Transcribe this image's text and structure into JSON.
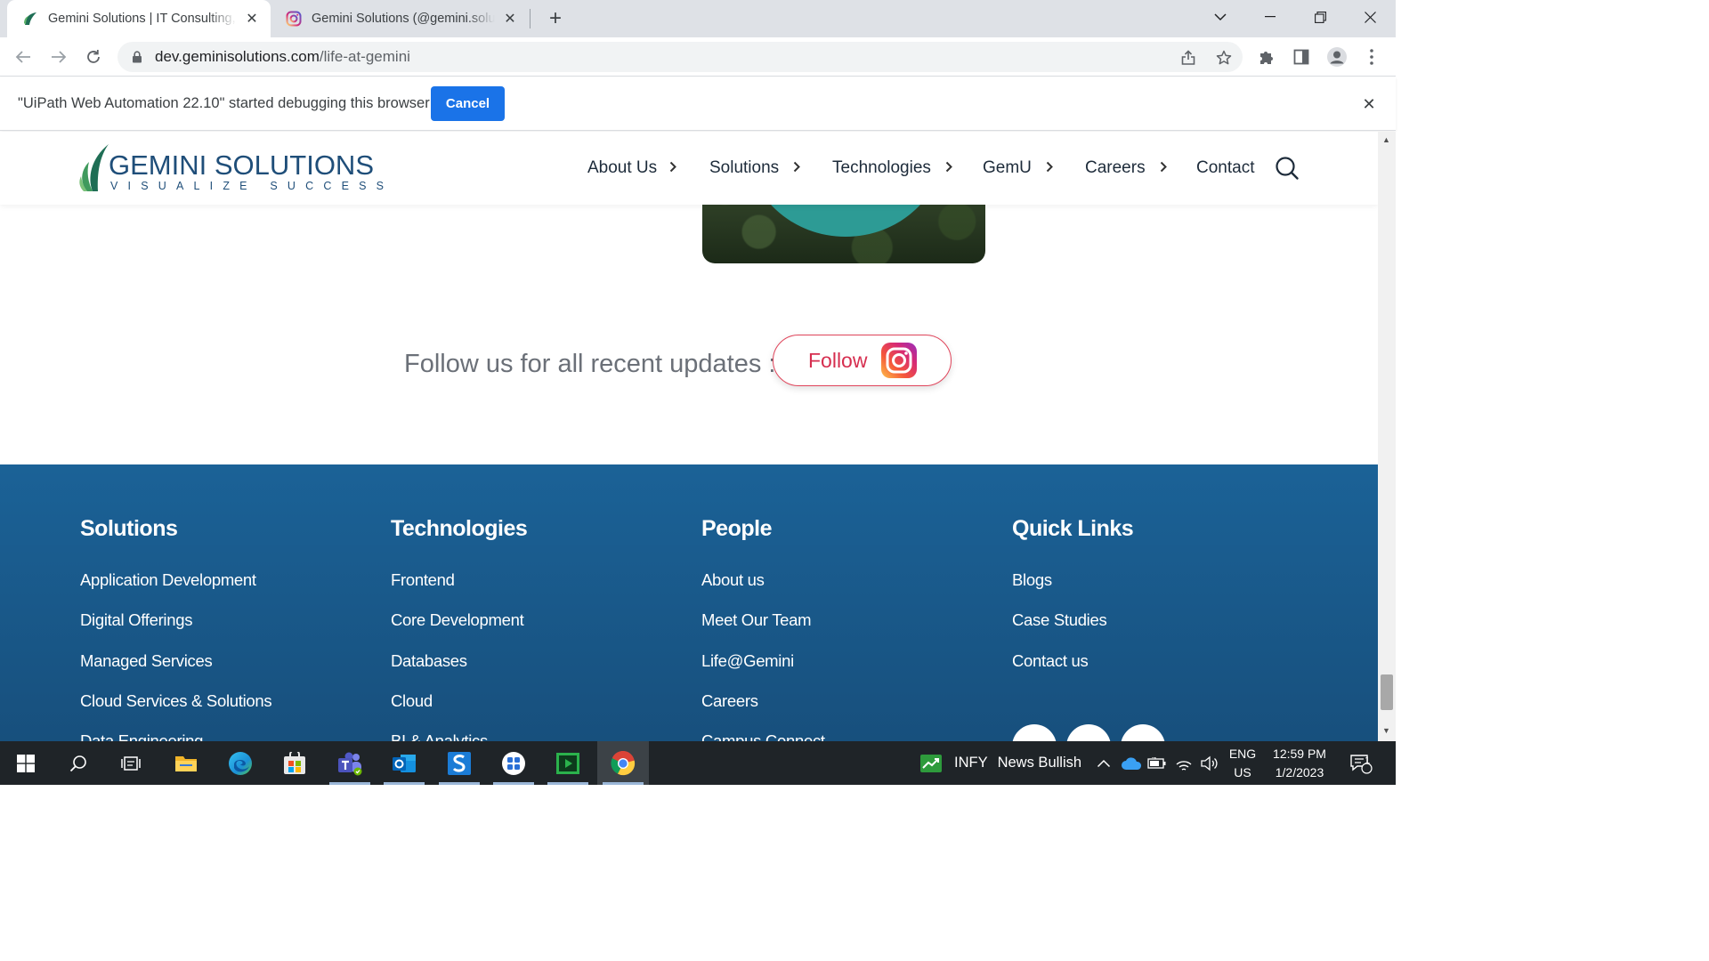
{
  "browser": {
    "tabs": [
      {
        "title": "Gemini Solutions | IT Consulting, Software Development",
        "active": true,
        "close": "✕"
      },
      {
        "title": "Gemini Solutions (@gemini.solutions) • Instagram",
        "active": false,
        "close": "✕"
      }
    ],
    "new_tab": "+",
    "url_domain": "dev.geminisolutions.com",
    "url_path": "/life-at-gemini"
  },
  "infobar": {
    "message": "\"UiPath Web Automation 22.10\" started debugging this browser",
    "cancel_label": "Cancel",
    "close": "✕"
  },
  "site": {
    "logo": {
      "word_main": "GEMINI",
      "word_rest": " SOLUTIONS",
      "tagline": "VISUALIZE SUCCESS"
    },
    "nav": [
      {
        "label": "About Us",
        "has_chevron": true
      },
      {
        "label": "Solutions",
        "has_chevron": true
      },
      {
        "label": "Technologies",
        "has_chevron": true
      },
      {
        "label": "GemU",
        "has_chevron": true
      },
      {
        "label": "Careers",
        "has_chevron": true
      },
      {
        "label": "Contact",
        "has_chevron": false
      }
    ],
    "chevron": "›",
    "follow_text": "Follow us for all recent updates :",
    "follow_button": "Follow"
  },
  "footer": {
    "columns": [
      {
        "heading": "Solutions",
        "links": [
          "Application Development",
          "Digital Offerings",
          "Managed Services",
          "Cloud Services & Solutions",
          "Data Engineering"
        ]
      },
      {
        "heading": "Technologies",
        "links": [
          "Frontend",
          "Core Development",
          "Databases",
          "Cloud",
          "BI & Analytics"
        ]
      },
      {
        "heading": "People",
        "links": [
          "About us",
          "Meet Our Team",
          "Life@Gemini",
          "Careers",
          "Campus Connect"
        ]
      },
      {
        "heading": "Quick Links",
        "links": [
          "Blogs",
          "Case Studies",
          "Contact us"
        ]
      }
    ],
    "social_icons": [
      "linkedin-icon",
      "facebook-icon",
      "instagram-icon"
    ]
  },
  "taskbar": {
    "stock_ticker": "INFY",
    "stock_status": "News Bullish",
    "lang_top": "ENG",
    "lang_bottom": "US",
    "time": "12:59 PM",
    "date": "1/2/2023",
    "notification_count": "1"
  },
  "colors": {
    "footer_bg": "#1b6297",
    "brand_navy": "#1f4e79",
    "instagram_red": "#d62e4f",
    "chrome_blue": "#1a73e8"
  }
}
